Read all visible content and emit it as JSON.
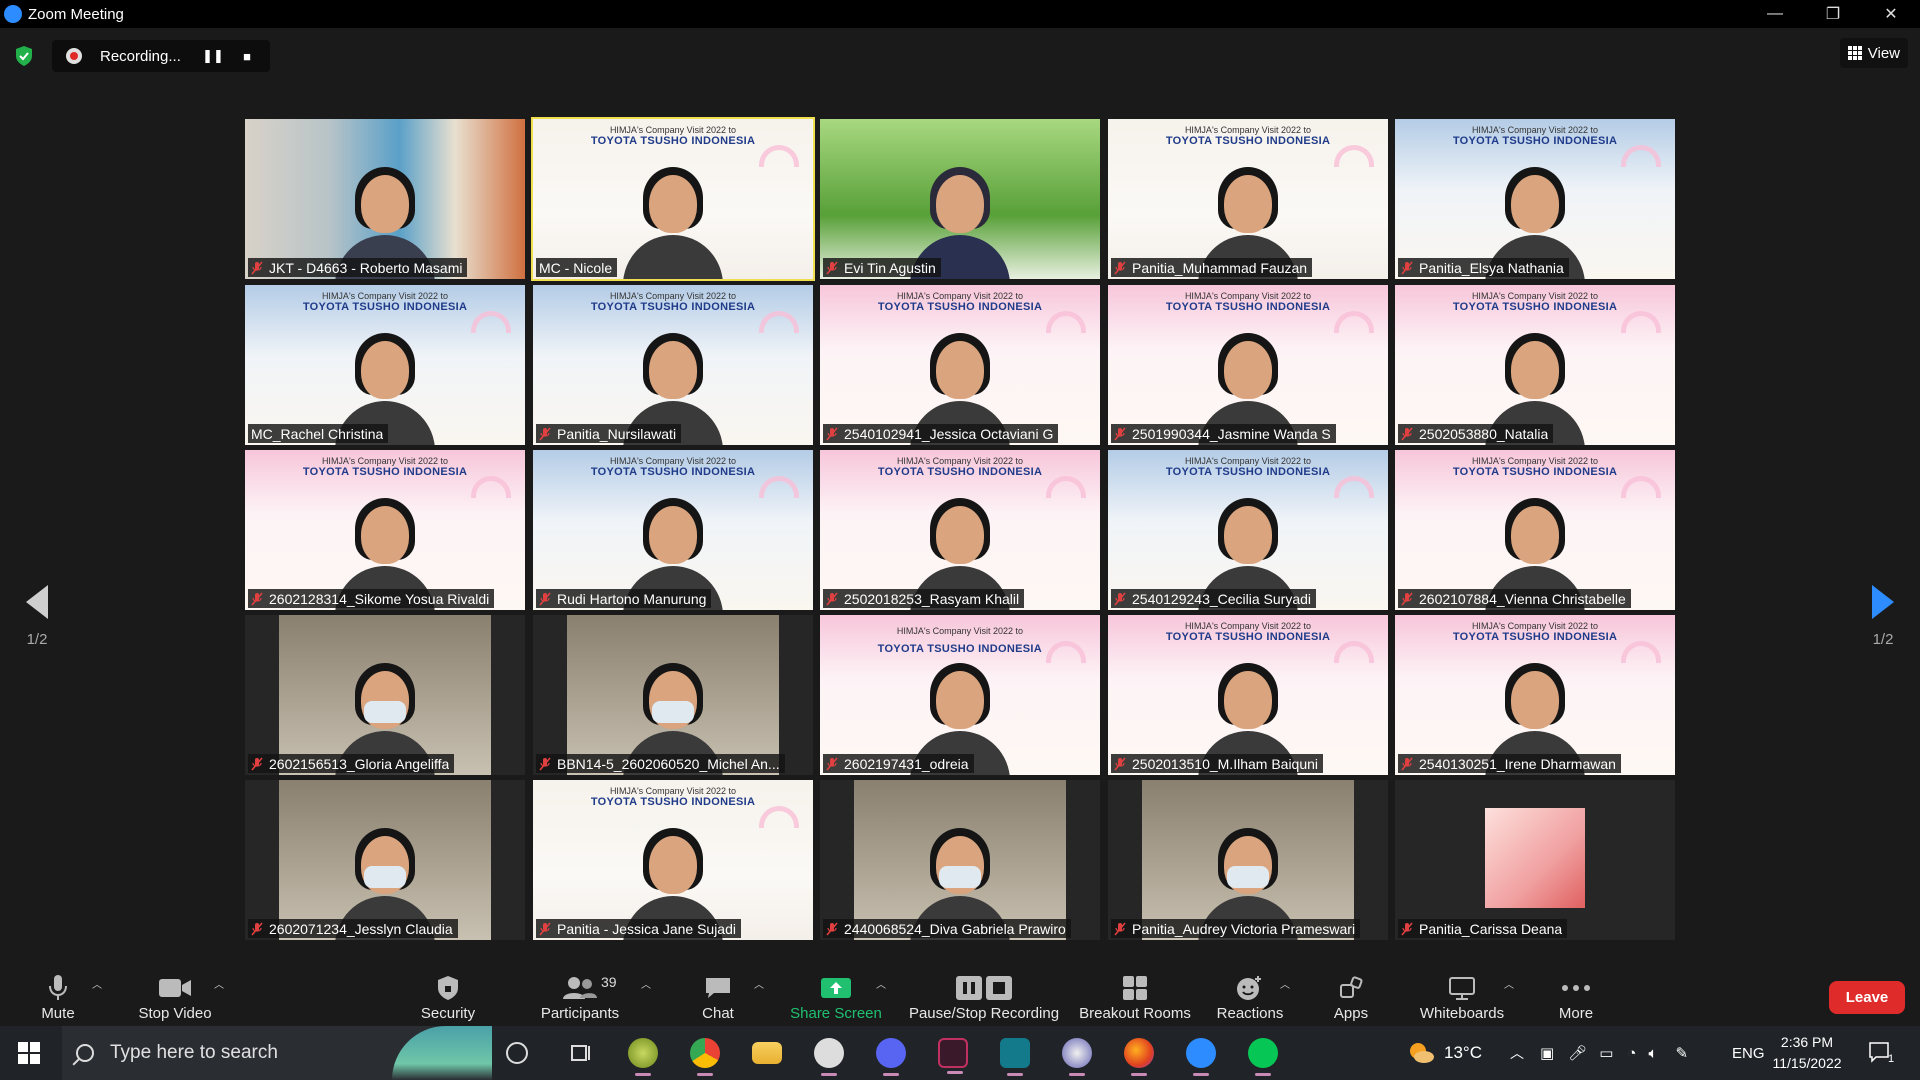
{
  "window": {
    "title": "Zoom Meeting",
    "controls": [
      "—",
      "❐",
      "✕"
    ]
  },
  "topbar": {
    "recording_label": "Recording...",
    "pause_symbol": "❚❚",
    "stop_symbol": "■",
    "view_label": "View"
  },
  "pager": {
    "left_text": "1/2",
    "right_text": "1/2"
  },
  "participants": [
    {
      "name": "JKT - D4663 - Roberto Masami",
      "muted": true,
      "bg": "office"
    },
    {
      "name": "MC - Nicole",
      "muted": false,
      "bg": "toyota",
      "active": true
    },
    {
      "name": "Evi Tin Agustin",
      "muted": true,
      "bg": "grass"
    },
    {
      "name": "Panitia_Muhammad Fauzan",
      "muted": true,
      "bg": "toyota"
    },
    {
      "name": "Panitia_Elsya Nathania",
      "muted": true,
      "bg": "blue"
    },
    {
      "name": "MC_Rachel Christina",
      "muted": false,
      "bg": "blue"
    },
    {
      "name": "Panitia_Nursilawati",
      "muted": true,
      "bg": "blue"
    },
    {
      "name": "2540102941_Jessica Octaviani G",
      "muted": true,
      "bg": "pink"
    },
    {
      "name": "2501990344_Jasmine Wanda S",
      "muted": true,
      "bg": "pink"
    },
    {
      "name": "2502053880_Natalia",
      "muted": true,
      "bg": "pink"
    },
    {
      "name": "2602128314_Sikome Yosua Rivaldi",
      "muted": true,
      "bg": "pink"
    },
    {
      "name": "Rudi Hartono Manurung",
      "muted": true,
      "bg": "blue"
    },
    {
      "name": "2502018253_Rasyam Khalil",
      "muted": true,
      "bg": "pink"
    },
    {
      "name": "2540129243_Cecilia Suryadi",
      "muted": true,
      "bg": "blue"
    },
    {
      "name": "2602107884_Vienna Christabelle",
      "muted": true,
      "bg": "pink"
    },
    {
      "name": "2602156513_Gloria Angeliffa",
      "muted": true,
      "bg": "photo"
    },
    {
      "name": "BBN14-5_2602060520_Michel An...",
      "muted": true,
      "bg": "photo"
    },
    {
      "name": "2602197431_odreia",
      "muted": true,
      "bg": "mirror"
    },
    {
      "name": "2502013510_M.Ilham Baiquni",
      "muted": true,
      "bg": "pink"
    },
    {
      "name": "2540130251_Irene Dharmawan",
      "muted": true,
      "bg": "pink"
    },
    {
      "name": "2602071234_Jesslyn Claudia",
      "muted": true,
      "bg": "photo"
    },
    {
      "name": "Panitia - Jessica Jane Sujadi",
      "muted": true,
      "bg": "toyota"
    },
    {
      "name": "2440068524_Diva Gabriela Prawiro",
      "muted": true,
      "bg": "photo"
    },
    {
      "name": "Panitia_Audrey Victoria Prameswari",
      "muted": true,
      "bg": "photo"
    },
    {
      "name": "Panitia_Carissa Deana",
      "muted": true,
      "bg": "avatar"
    }
  ],
  "banner": {
    "line1": "HIMJA's Company Visit 2022 to",
    "line2": "TOYOTA TSUSHO INDONESIA"
  },
  "toolbar": {
    "mute": "Mute",
    "stop_video": "Stop Video",
    "security": "Security",
    "participants": "Participants",
    "participants_count": "39",
    "chat": "Chat",
    "share_screen": "Share Screen",
    "pause_stop_recording": "Pause/Stop Recording",
    "breakout_rooms": "Breakout Rooms",
    "reactions": "Reactions",
    "apps": "Apps",
    "whiteboards": "Whiteboards",
    "more": "More",
    "leave": "Leave"
  },
  "taskbar": {
    "search_placeholder": "Type here to search",
    "weather": "13°C",
    "language": "ENG",
    "time": "2:36 PM",
    "date": "11/15/2022",
    "notification_count": "1"
  },
  "colors": {
    "accent_blue": "#2d8cff",
    "share_green": "#20c070",
    "leave_red": "#e02b2b",
    "muted_red": "#e04040",
    "active_speaker": "#f0e050"
  }
}
